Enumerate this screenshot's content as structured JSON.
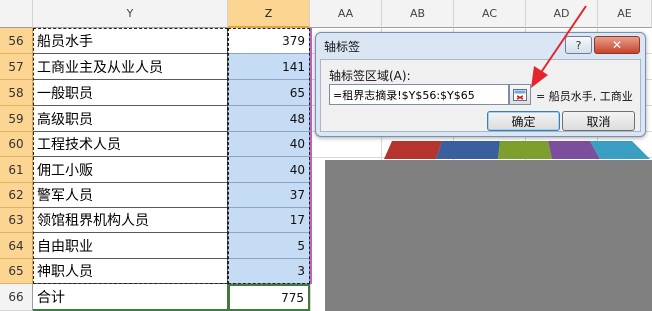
{
  "columns": {
    "y": "Y",
    "z": "Z",
    "others": [
      "AA",
      "AB",
      "AC",
      "AD",
      "AE"
    ]
  },
  "rows": [
    {
      "num": "56",
      "label": "船员水手",
      "value": "379"
    },
    {
      "num": "57",
      "label": "工商业主及从业人员",
      "value": "141"
    },
    {
      "num": "58",
      "label": "一般职员",
      "value": "65"
    },
    {
      "num": "59",
      "label": "高级职员",
      "value": "48"
    },
    {
      "num": "60",
      "label": "工程技术人员",
      "value": "40"
    },
    {
      "num": "61",
      "label": "佣工小贩",
      "value": "40"
    },
    {
      "num": "62",
      "label": "警军人员",
      "value": "37"
    },
    {
      "num": "63",
      "label": "领馆租界机构人员",
      "value": "17"
    },
    {
      "num": "64",
      "label": "自由职业",
      "value": "5"
    },
    {
      "num": "65",
      "label": "神职人员",
      "value": "3"
    }
  ],
  "total_row": {
    "num": "66",
    "label": "合计",
    "value": "775"
  },
  "dialog": {
    "title": "轴标签",
    "help": "?",
    "close": "✕",
    "range_label": "轴标签区域(A):",
    "range_value": "=租界志摘录!$Y$56:$Y$65",
    "preview": "= 船员水手, 工商业",
    "ok": "确定",
    "cancel": "取消"
  },
  "colors": {
    "selection_header": "#fcd592",
    "selected_cells": "#c6dcf4",
    "arrow": "#e3262b",
    "chart_gray": "#808080"
  }
}
